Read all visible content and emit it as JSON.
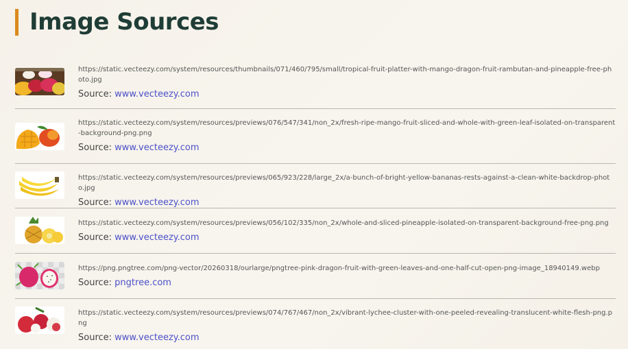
{
  "page": {
    "title": "Image Sources"
  },
  "source_label": "Source:",
  "items": [
    {
      "url": "https://static.vecteezy.com/system/resources/thumbnails/071/460/795/small/tropical-fruit-platter-with-mango-dragon-fruit-rambutan-and-pineapple-free-photo.jpg",
      "source": "www.vecteezy.com",
      "thumb": "fruit-platter-thumbnail"
    },
    {
      "url": "https://static.vecteezy.com/system/resources/previews/076/547/341/non_2x/fresh-ripe-mango-fruit-sliced-and-whole-with-green-leaf-isolated-on-transparent-background-png.png",
      "source": "www.vecteezy.com",
      "thumb": "mango-thumbnail"
    },
    {
      "url": "https://static.vecteezy.com/system/resources/previews/065/923/228/large_2x/a-bunch-of-bright-yellow-bananas-rests-against-a-clean-white-backdrop-photo.jpg",
      "source": "www.vecteezy.com",
      "thumb": "banana-thumbnail"
    },
    {
      "url": "https://static.vecteezy.com/system/resources/previews/056/102/335/non_2x/whole-and-sliced-pineapple-isolated-on-transparent-background-free-png.png",
      "source": "www.vecteezy.com",
      "thumb": "pineapple-thumbnail"
    },
    {
      "url": "https://png.pngtree.com/png-vector/20260318/ourlarge/pngtree-pink-dragon-fruit-with-green-leaves-and-one-half-cut-open-png-image_18940149.webp",
      "source": "pngtree.com",
      "thumb": "dragon-fruit-thumbnail"
    },
    {
      "url": "https://static.vecteezy.com/system/resources/previews/074/767/467/non_2x/vibrant-lychee-cluster-with-one-peeled-revealing-translucent-white-flesh-png.png",
      "source": "www.vecteezy.com",
      "thumb": "lychee-thumbnail"
    }
  ]
}
